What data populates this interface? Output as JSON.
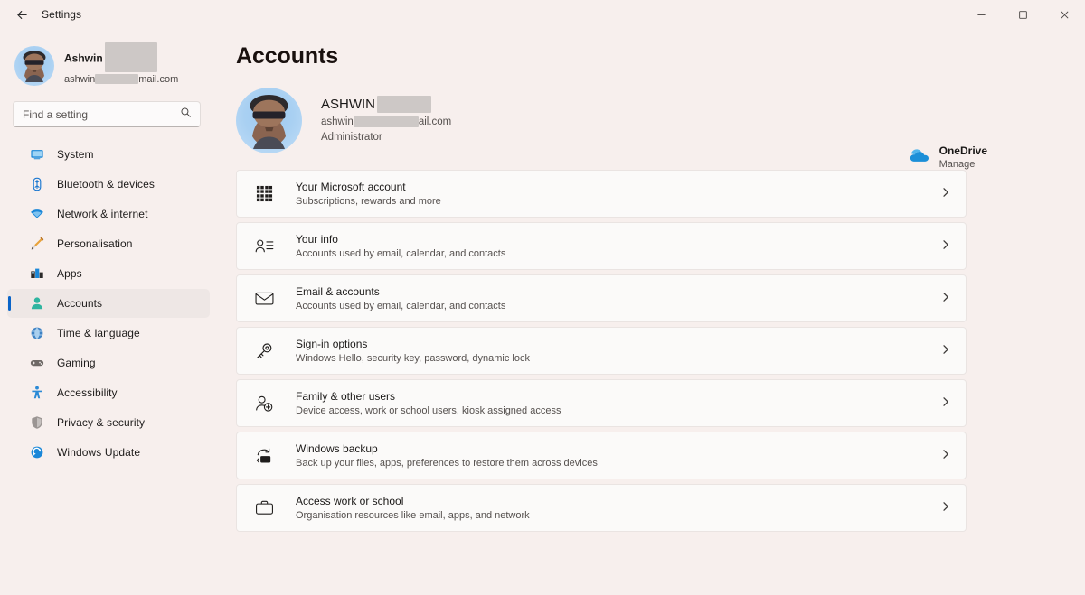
{
  "window": {
    "titlebar_title": "Settings",
    "back_icon": "back-arrow-icon",
    "minimize_label": "–",
    "maximize_label": "☐",
    "close_label": "✕"
  },
  "sidebar": {
    "profile": {
      "name": "Ashwin",
      "email_prefix": "ashwin",
      "email_suffix": "mail.com",
      "avatar_icon": "user-avatar"
    },
    "search": {
      "placeholder": "Find a setting",
      "value": "",
      "icon": "search-icon"
    },
    "items": [
      {
        "label": "System",
        "icon": "monitor-icon",
        "active": false
      },
      {
        "label": "Bluetooth & devices",
        "icon": "bluetooth-icon",
        "active": false
      },
      {
        "label": "Network & internet",
        "icon": "wifi-icon",
        "active": false
      },
      {
        "label": "Personalisation",
        "icon": "paintbrush-icon",
        "active": false
      },
      {
        "label": "Apps",
        "icon": "apps-icon",
        "active": false
      },
      {
        "label": "Accounts",
        "icon": "person-icon",
        "active": true
      },
      {
        "label": "Time & language",
        "icon": "clock-globe-icon",
        "active": false
      },
      {
        "label": "Gaming",
        "icon": "gamepad-icon",
        "active": false
      },
      {
        "label": "Accessibility",
        "icon": "accessibility-icon",
        "active": false
      },
      {
        "label": "Privacy & security",
        "icon": "shield-icon",
        "active": false
      },
      {
        "label": "Windows Update",
        "icon": "update-icon",
        "active": false
      }
    ]
  },
  "main": {
    "page_title": "Accounts",
    "account": {
      "name": "ASHWIN",
      "email_prefix": "ashwin",
      "email_suffix": "ail.com",
      "role": "Administrator",
      "avatar_icon": "user-avatar"
    },
    "onedrive": {
      "title": "OneDrive",
      "subtitle": "Manage",
      "icon": "onedrive-cloud-icon"
    },
    "cards": [
      {
        "title": "Your Microsoft account",
        "subtitle": "Subscriptions, rewards and more",
        "icon": "microsoft-logo-icon",
        "chevron": "chevron-right-icon"
      },
      {
        "title": "Your info",
        "subtitle": "Accounts used by email, calendar, and contacts",
        "icon": "user-details-icon",
        "chevron": "chevron-right-icon"
      },
      {
        "title": "Email & accounts",
        "subtitle": "Accounts used by email, calendar, and contacts",
        "icon": "envelope-icon",
        "chevron": "chevron-right-icon"
      },
      {
        "title": "Sign-in options",
        "subtitle": "Windows Hello, security key, password, dynamic lock",
        "icon": "key-icon",
        "chevron": "chevron-right-icon"
      },
      {
        "title": "Family & other users",
        "subtitle": "Device access, work or school users, kiosk assigned access",
        "icon": "add-user-icon",
        "chevron": "chevron-right-icon"
      },
      {
        "title": "Windows backup",
        "subtitle": "Back up your files, apps, preferences to restore them across devices",
        "icon": "backup-sync-icon",
        "chevron": "chevron-right-icon"
      },
      {
        "title": "Access work or school",
        "subtitle": "Organisation resources like email, apps, and network",
        "icon": "briefcase-icon",
        "chevron": "chevron-right-icon"
      }
    ]
  },
  "colors": {
    "page_background": "#f7efed",
    "card_background": "#fbfaf9",
    "accent_blue": "#0a64c8",
    "avatar_blue": "#a9d0f2",
    "text_primary": "#1a1817",
    "text_secondary": "#55504e"
  }
}
